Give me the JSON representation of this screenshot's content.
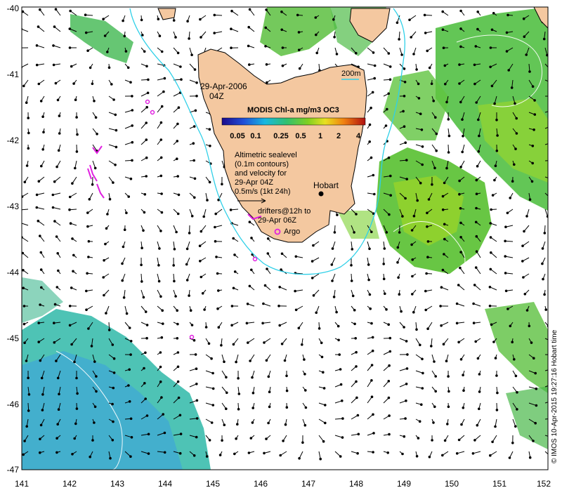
{
  "map": {
    "lon_ticks": [
      "141",
      "142",
      "143",
      "144",
      "145",
      "146",
      "147",
      "148",
      "149",
      "150",
      "151",
      "152"
    ],
    "lat_ticks": [
      "-40",
      "-41",
      "-42",
      "-43",
      "-44",
      "-45",
      "-46",
      "-47"
    ],
    "lon_range": [
      141,
      152
    ],
    "lat_range": [
      -47,
      -40
    ],
    "date_line1": "29-Apr-2006",
    "date_line2": "04Z",
    "scale_label": "200m",
    "colorbar": {
      "title": "MODIS Chl-a mg/m3 OC3",
      "ticks": [
        "0.05",
        "0.1",
        "0.25",
        "0.5",
        "1",
        "2",
        "4"
      ]
    },
    "notes": {
      "line1": "Altimetric sealevel",
      "line2": "(0.1m contours)",
      "line3": "and velocity for",
      "line4": "29-Apr 04Z",
      "line5": "0.5m/s (1kt 24h)"
    },
    "hobart_label": "Hobart",
    "drifters": {
      "line1": "drifters@12h to",
      "line2": "29-Apr 06Z"
    },
    "argo_label": "Argo",
    "credit": "© IMOS 10-Apr-2015 19:27:16 Hobart time",
    "colors": {
      "land": "#f4c8a0",
      "bathy": "#2fd0e8",
      "drifter": "#e020e0",
      "chl_low": "#2a9ad8",
      "chl_mid": "#30b850",
      "chl_high": "#c0d820"
    }
  }
}
